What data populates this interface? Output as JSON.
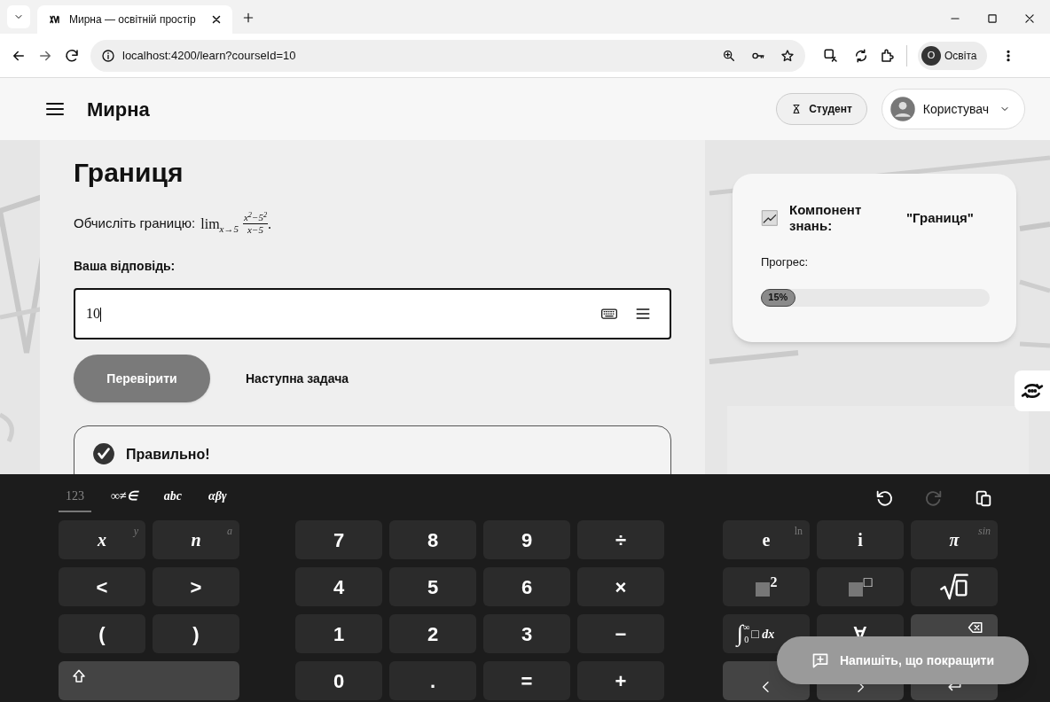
{
  "browser": {
    "tab_title": "Мирна — освітній простір",
    "url": "localhost:4200/learn?courseId=10",
    "profile_initial": "О",
    "profile_name": "Освіта"
  },
  "header": {
    "app_name": "Мирна",
    "role_button": "Студент",
    "user_name": "Користувач"
  },
  "task": {
    "title": "Границя",
    "prompt": "Обчисліть границю:",
    "limit": "lim",
    "limit_sub": "x→5",
    "numerator": "x$^{2}$−5$^{2}$",
    "denominator": "x−5",
    "end": ".",
    "answer_label": "Ваша відповідь:",
    "answer_value": "10",
    "check_button": "Перевірити",
    "next_button": "Наступна задача",
    "result": "Правильно!"
  },
  "component_card": {
    "title": "Компонент знань:",
    "name": "\"Границя\"",
    "progress_label": "Прогрес:",
    "level": 0.15,
    "progress_text": "15%"
  },
  "keyboard": {
    "tabs": [
      {
        "label": "123",
        "selected": true
      },
      {
        "label": "∞≠∈",
        "selected": false
      },
      {
        "label": "abc",
        "selected": false
      },
      {
        "label": "αβγ",
        "selected": false
      }
    ],
    "redo_disabled": true,
    "groups": [
      {
        "kind": "variables",
        "keys": [
          {
            "kind": "math",
            "label": "x",
            "italic": true,
            "alt": "y"
          },
          {
            "kind": "math",
            "label": "n",
            "italic": true,
            "alt": "a"
          },
          {
            "kind": "symbol",
            "label": "<"
          },
          {
            "kind": "symbol",
            "label": ">"
          },
          {
            "kind": "symbol",
            "label": "("
          },
          {
            "kind": "symbol",
            "label": ")"
          },
          {
            "kind": "shift",
            "wide": true
          }
        ]
      },
      {
        "kind": "digits",
        "keys": [
          {
            "kind": "symbol",
            "label": "7"
          },
          {
            "kind": "symbol",
            "label": "8"
          },
          {
            "kind": "symbol",
            "label": "9"
          },
          {
            "kind": "symbol",
            "label": "÷"
          },
          {
            "kind": "symbol",
            "label": "4"
          },
          {
            "kind": "symbol",
            "label": "5"
          },
          {
            "kind": "symbol",
            "label": "6"
          },
          {
            "kind": "symbol",
            "label": "×"
          },
          {
            "kind": "symbol",
            "label": "1"
          },
          {
            "kind": "symbol",
            "label": "2"
          },
          {
            "kind": "symbol",
            "label": "3"
          },
          {
            "kind": "symbol",
            "label": "−"
          },
          {
            "kind": "symbol",
            "label": "0"
          },
          {
            "kind": "symbol",
            "label": "."
          },
          {
            "kind": "symbol",
            "label": "="
          },
          {
            "kind": "symbol",
            "label": "+"
          }
        ]
      },
      {
        "kind": "functions",
        "keys": [
          {
            "kind": "math",
            "label": "e",
            "italic": false,
            "alt": "ln"
          },
          {
            "kind": "math",
            "label": "i",
            "italic": false
          },
          {
            "kind": "math",
            "label": "π",
            "italic": true,
            "alt": "sin"
          },
          {
            "kind": "power",
            "exponent": "2"
          },
          {
            "kind": "power",
            "exponent": "□"
          },
          {
            "kind": "sqrt"
          },
          {
            "kind": "integral",
            "sign": "∫",
            "upper": "∞",
            "lower": "0",
            "tail": "□ dx"
          },
          {
            "kind": "math",
            "label": "∀",
            "italic": false
          },
          {
            "kind": "backspace"
          },
          {
            "kind": "left"
          },
          {
            "kind": "right"
          },
          {
            "kind": "enter"
          }
        ]
      }
    ]
  },
  "feedback_button": "Напишіть, що покращити"
}
